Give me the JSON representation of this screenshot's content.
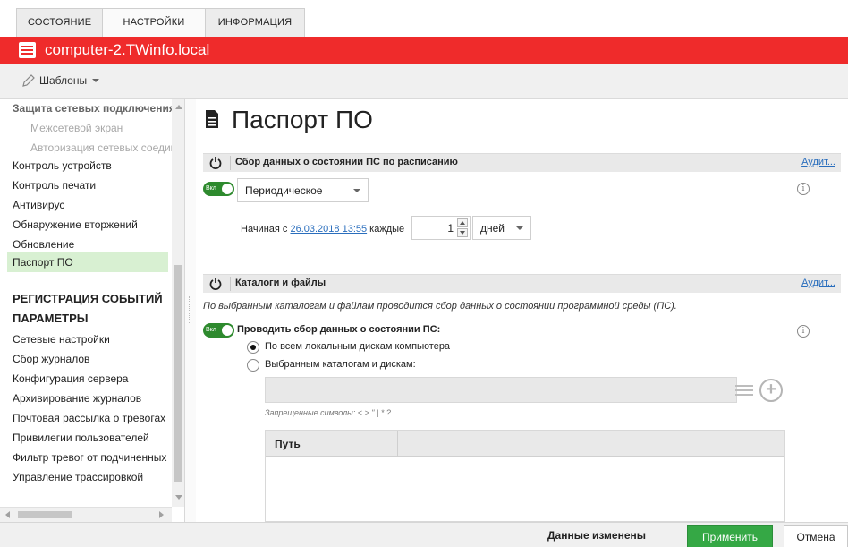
{
  "tabs": [
    {
      "label": "СОСТОЯНИЕ"
    },
    {
      "label": "НАСТРОЙКИ"
    },
    {
      "label": "ИНФОРМАЦИЯ"
    }
  ],
  "header": {
    "title": "computer-2.TWinfo.local",
    "color": "#ef2b2b"
  },
  "toolbar": {
    "templates_label": "Шаблоны"
  },
  "sidebar": {
    "items": [
      {
        "label": "Защита сетевых подключения"
      },
      {
        "label": "Межсетевой экран"
      },
      {
        "label": "Авторизация сетевых соединений"
      },
      {
        "label": "Контроль устройств"
      },
      {
        "label": "Контроль печати"
      },
      {
        "label": "Антивирус"
      },
      {
        "label": "Обнаружение вторжений"
      },
      {
        "label": "Обновление"
      },
      {
        "label": "Паспорт ПО"
      },
      {
        "label": "РЕГИСТРАЦИЯ СОБЫТИЙ"
      },
      {
        "label": "ПАРАМЕТРЫ"
      },
      {
        "label": "Сетевые настройки"
      },
      {
        "label": "Сбор журналов"
      },
      {
        "label": "Конфигурация сервера"
      },
      {
        "label": "Архивирование журналов"
      },
      {
        "label": "Почтовая рассылка о тревогах"
      },
      {
        "label": "Привилегии пользователей"
      },
      {
        "label": "Фильтр тревог от подчиненных"
      },
      {
        "label": "Управление трассировкой"
      }
    ]
  },
  "main": {
    "title": "Паспорт ПО",
    "section1": {
      "header": "Сбор данных о состоянии ПС по расписанию",
      "audit": "Аудит...",
      "toggle_label": "Вкл",
      "mode": "Периодическое",
      "start_prefix": "Начиная с",
      "start_date": "26.03.2018 13:55",
      "every_label": "каждые",
      "interval_value": "1",
      "interval_unit": "дней"
    },
    "section2": {
      "header": "Каталоги и файлы",
      "audit": "Аудит...",
      "description": "По выбранным каталогам и файлам проводится сбор данных о состоянии программной среды (ПС).",
      "toggle_label": "Вкл",
      "collect_label": "Проводить сбор данных о состоянии ПС:",
      "radio_all": "По всем локальным дискам компьютера",
      "radio_selected": "Выбранным каталогам и дискам:",
      "forbidden": "Запрещенные символы: < > \" | * ?",
      "column_path": "Путь"
    },
    "info_symbol": "i"
  },
  "footer": {
    "status": "Данные изменены",
    "apply": "Применить",
    "cancel": "Отмена"
  },
  "colors": {
    "accent_green": "#35a845",
    "toggle_green": "#2e8a2e",
    "selected_bg": "#d8f0d2",
    "link": "#2a6ebd"
  }
}
